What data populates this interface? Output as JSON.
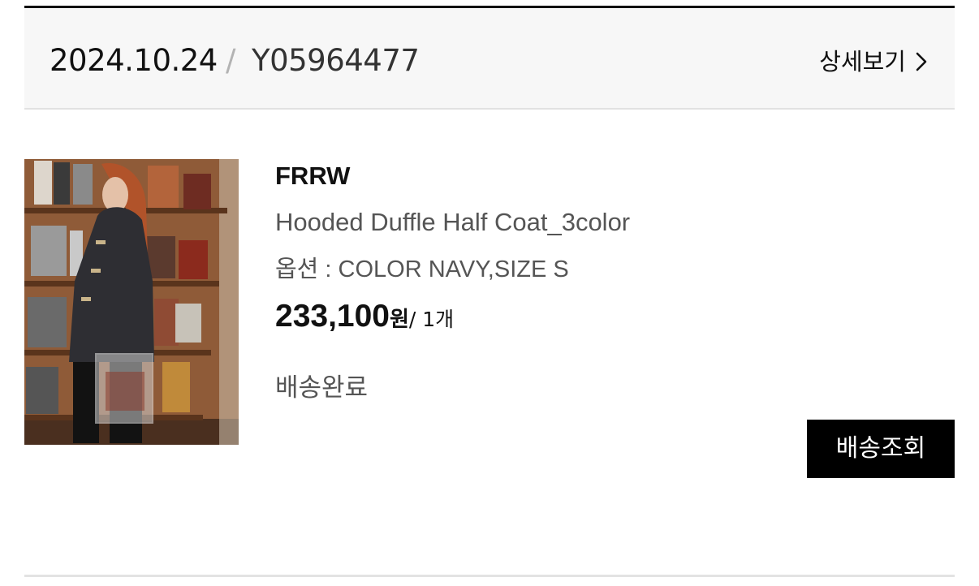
{
  "order": {
    "date": "2024.10.24",
    "separator": "/",
    "number": "Y05964477",
    "detail_link_label": "상세보기",
    "detail_link_icon": "chevron-right-icon"
  },
  "item": {
    "brand": "FRRW",
    "name": "Hooded Duffle Half Coat_3color",
    "option": "옵션 : COLOR NAVY,SIZE S",
    "price": "233,100",
    "currency": "원",
    "quantity": "/ 1개",
    "status": "배송완료",
    "track_button_label": "배송조회"
  },
  "colors": {
    "header_bg": "#f7f7f7",
    "top_rule": "#111111",
    "button_bg": "#000000",
    "muted_text": "#555555"
  }
}
